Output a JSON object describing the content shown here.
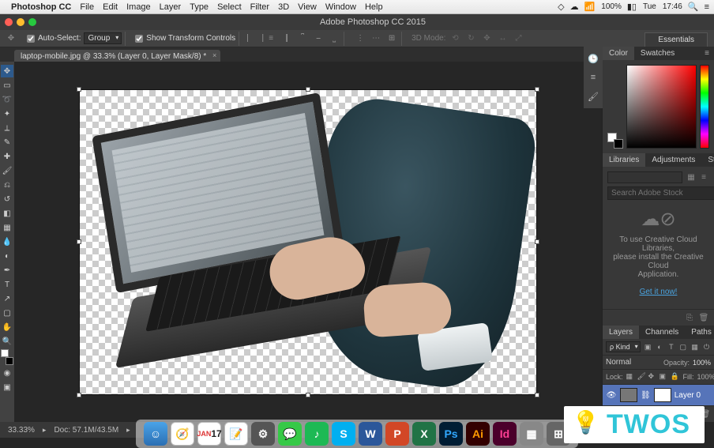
{
  "mac_menu": {
    "app": "Photoshop CC",
    "items": [
      "File",
      "Edit",
      "Image",
      "Layer",
      "Type",
      "Select",
      "Filter",
      "3D",
      "View",
      "Window",
      "Help"
    ],
    "battery": "100%",
    "battery_icon": "🔋",
    "day": "Tue",
    "time": "17:46"
  },
  "app": {
    "title": "Adobe Photoshop CC 2015"
  },
  "options": {
    "auto_select_label": "Auto-Select:",
    "auto_select_value": "Group",
    "show_transform_label": "Show Transform Controls",
    "mode_label": "3D Mode:"
  },
  "workspace_switcher": "Essentials",
  "doc_tab": {
    "name": "laptop-mobile.jpg @ 33.3% (Layer 0, Layer Mask/8) *"
  },
  "status": {
    "zoom": "33.33%",
    "doc": "Doc: 57.1M/43.5M"
  },
  "panels": {
    "color_tabs": [
      "Color",
      "Swatches"
    ],
    "mid_tabs": [
      "Libraries",
      "Adjustments",
      "Styles"
    ],
    "libraries": {
      "search_placeholder": "Search Adobe Stock",
      "msg1": "To use Creative Cloud Libraries,",
      "msg2": "please install the Creative Cloud",
      "msg3": "Application.",
      "cta": "Get it now!"
    },
    "layers_tabs": [
      "Layers",
      "Channels",
      "Paths"
    ],
    "layers": {
      "kind": "Kind",
      "blend": "Normal",
      "opacity_label": "Opacity:",
      "opacity_value": "100%",
      "lock_label": "Lock:",
      "fill_label": "Fill:",
      "fill_value": "100%",
      "layer0_name": "Layer 0"
    }
  },
  "dock": {
    "cal_month": "JAN",
    "cal_day": "17",
    "word": "W",
    "ppt": "P",
    "xls": "X",
    "ps": "Ps",
    "ai": "Ai",
    "id": "Id"
  },
  "watermark": "TWOS"
}
